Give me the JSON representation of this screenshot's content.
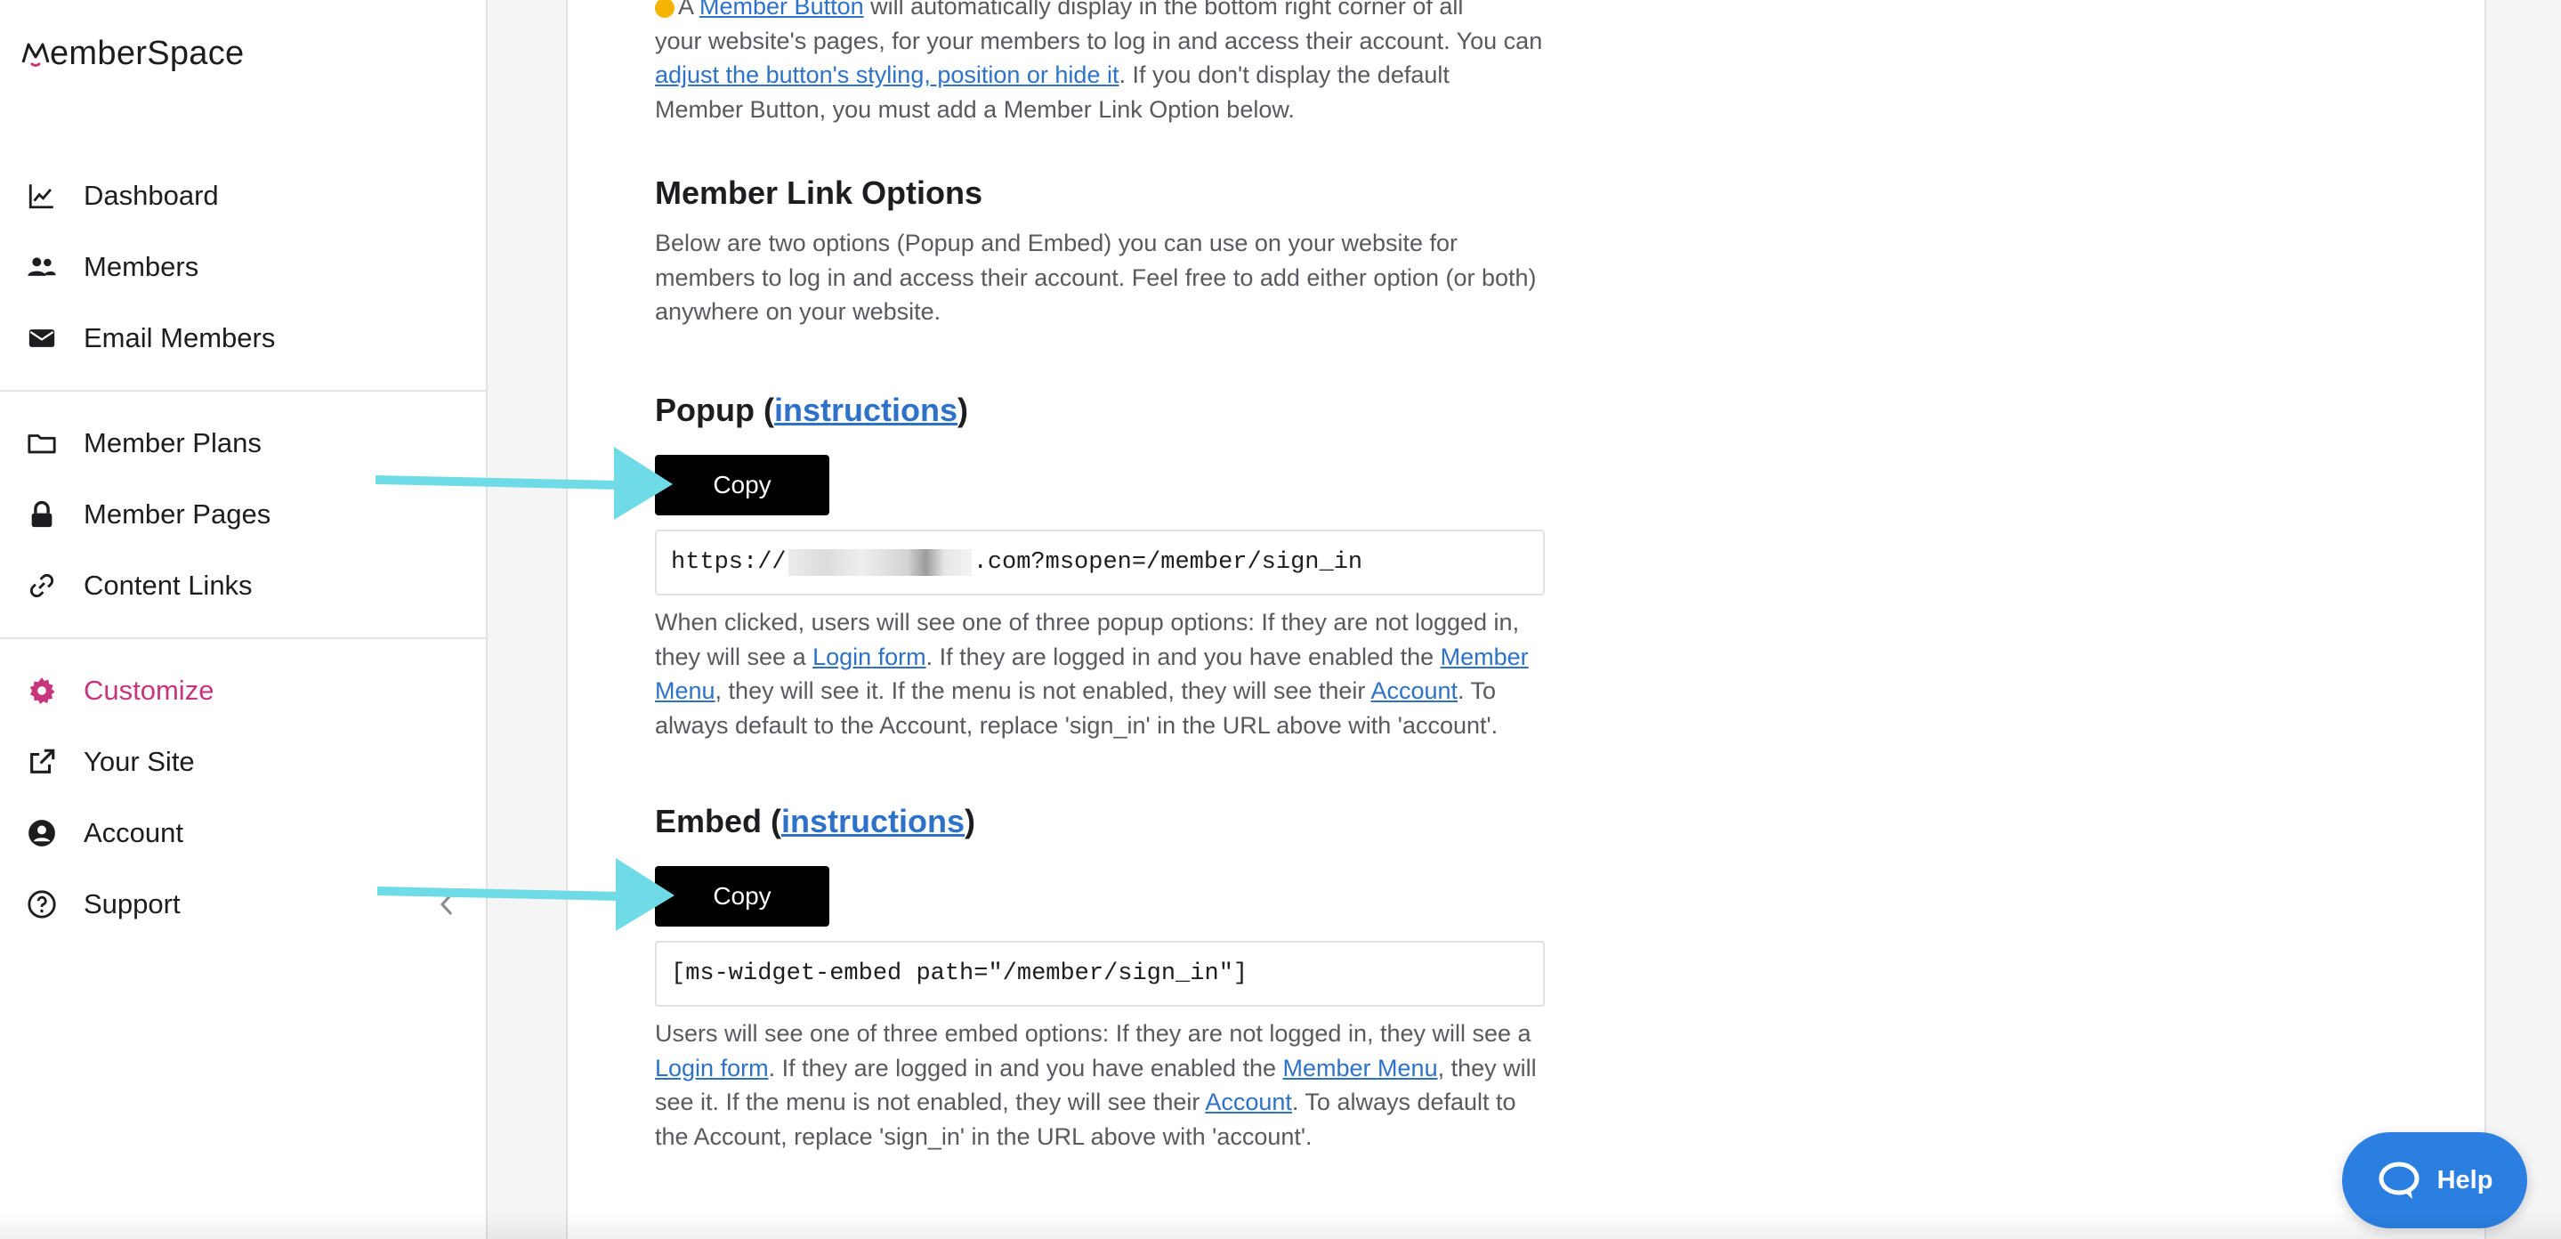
{
  "app": {
    "brand": "MemberSpace",
    "brand_rest": "emberSpace"
  },
  "sidebar": {
    "groups": [
      [
        {
          "label": "Dashboard",
          "icon": "chart-line-icon"
        },
        {
          "label": "Members",
          "icon": "users-icon"
        },
        {
          "label": "Email Members",
          "icon": "envelope-icon"
        }
      ],
      [
        {
          "label": "Member Plans",
          "icon": "folder-icon"
        },
        {
          "label": "Member Pages",
          "icon": "lock-icon"
        },
        {
          "label": "Content Links",
          "icon": "link-icon"
        }
      ],
      [
        {
          "label": "Customize",
          "icon": "gear-icon",
          "active": true
        },
        {
          "label": "Your Site",
          "icon": "external-link-icon"
        },
        {
          "label": "Account",
          "icon": "user-circle-icon"
        },
        {
          "label": "Support",
          "icon": "question-circle-icon"
        }
      ]
    ],
    "active_color": "#c7367c"
  },
  "intro": {
    "line1_link": "Member Button",
    "line1_rest": " will automatically display in the bottom right corner of all",
    "line2": "your website's pages, for your members to log in and access their account. You can",
    "line3_link": "adjust the button's styling, position or hide it",
    "line3_rest": ". If you don't display the default",
    "line4": "Member Button, you must add a Member Link Option below."
  },
  "link_options": {
    "heading": "Member Link Options",
    "description": "Below are two options (Popup and Embed) you can use on your website for members to log in and access their account. Feel free to add either option (or both) anywhere on your website."
  },
  "popup": {
    "title": "Popup",
    "instructions_label": "instructions",
    "copy_label": "Copy",
    "code_prefix": "https://",
    "code_suffix": ".com?msopen=/member/sign_in",
    "desc_a": "When clicked, users will see one of three popup options: If they are not logged in, they will see a ",
    "login_form": "Login form",
    "desc_b": ". If they are logged in and you have enabled the ",
    "member_menu": "Member Menu",
    "desc_c": ", they will see it. If the menu is not enabled, they will see their ",
    "account": "Account",
    "desc_d": ". To always default to the Account, replace 'sign_in' in the URL above with 'account'."
  },
  "embed": {
    "title": "Embed",
    "instructions_label": "instructions",
    "copy_label": "Copy",
    "code": "[ms-widget-embed path=\"/member/sign_in\"]",
    "desc_a": "Users will see one of three embed options: If they are not logged in, they will see a ",
    "login_form": "Login form",
    "desc_b": ". If they are logged in and you have enabled the ",
    "member_menu": "Member Menu",
    "desc_c": ", they will see it. If the menu is not enabled, they will see their ",
    "account": "Account",
    "desc_d": ". To always default to the Account, replace 'sign_in' in the URL above with 'account'."
  },
  "help": {
    "label": "Help"
  },
  "colors": {
    "link": "#2d72c8",
    "arrow": "#6fdbe6",
    "help_bg": "#2b7fe0"
  }
}
